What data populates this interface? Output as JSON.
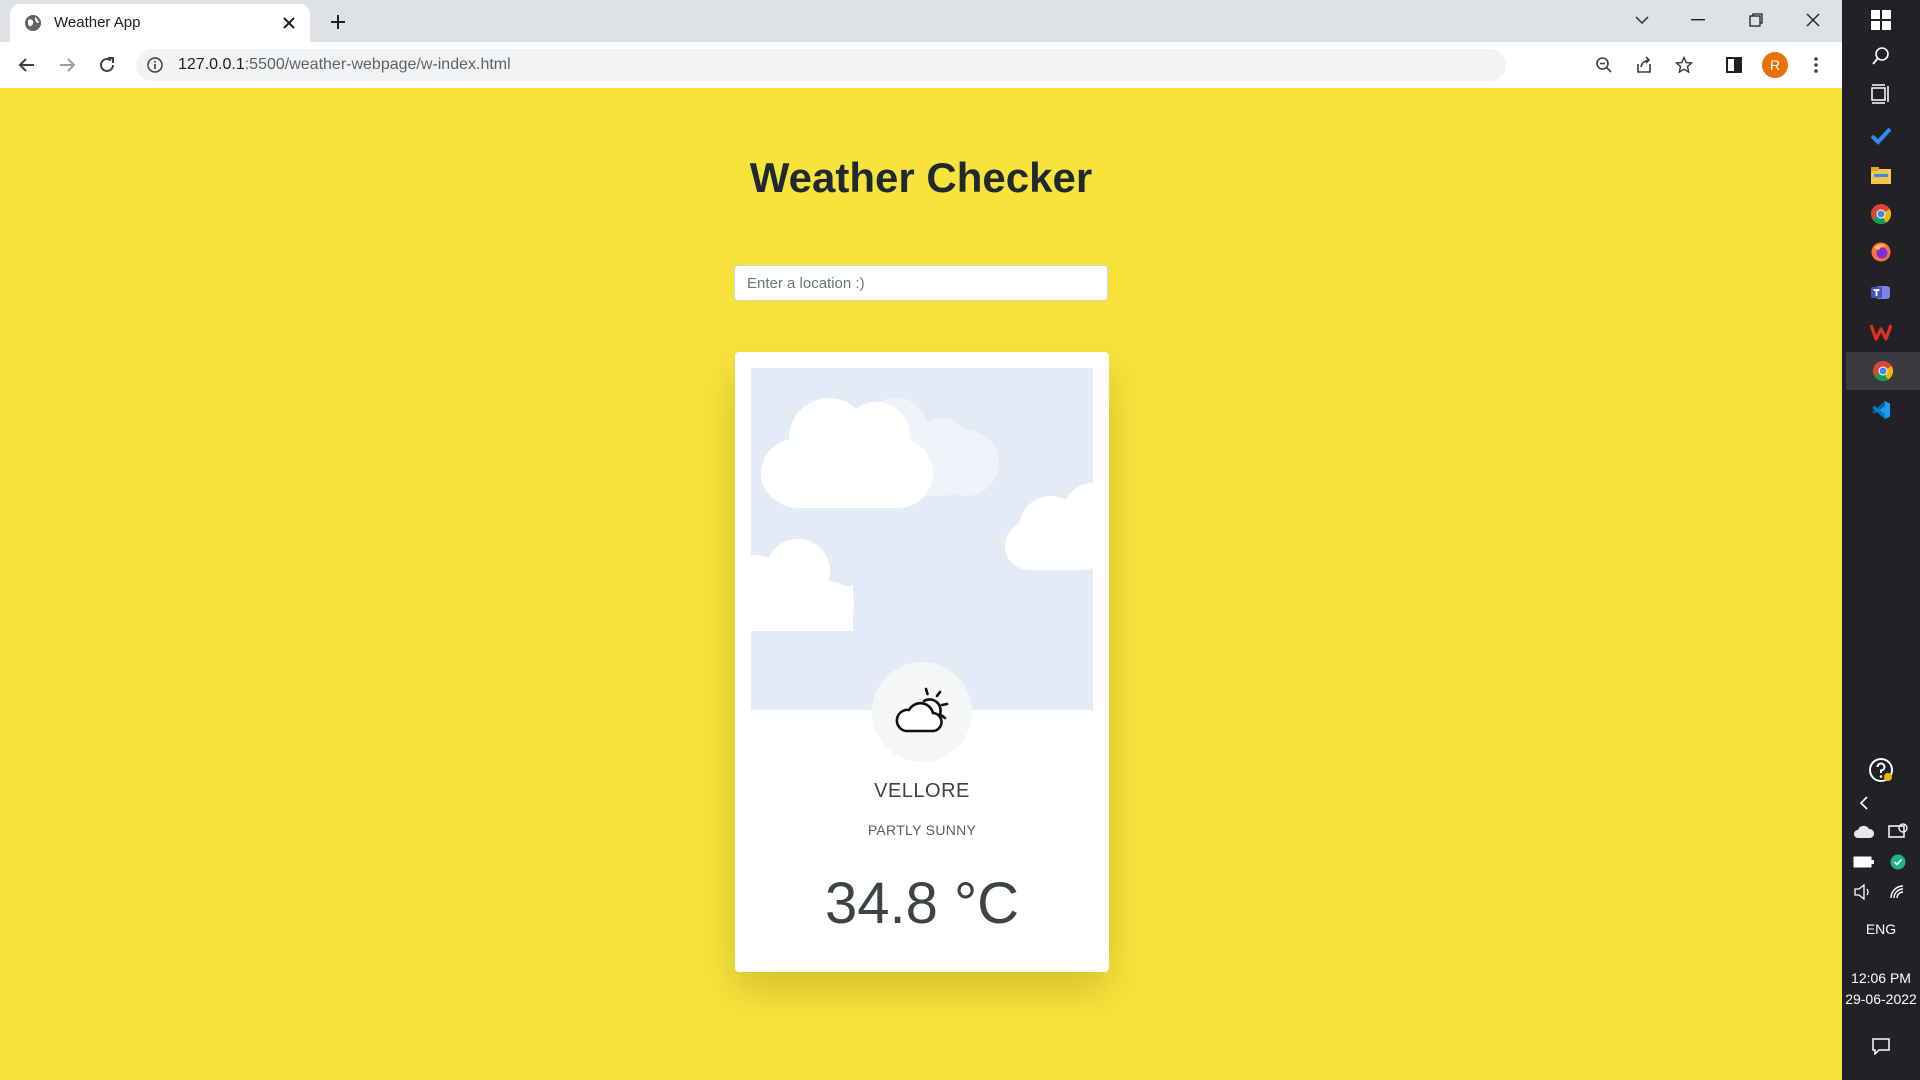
{
  "browser": {
    "tab_title": "Weather App",
    "url_host": "127.0.0.1",
    "url_path": ":5500/weather-webpage/w-index.html",
    "profile_initial": "R"
  },
  "page": {
    "title": "Weather Checker",
    "search_placeholder": "Enter a location :)",
    "search_value": ""
  },
  "weather": {
    "city": "VELLORE",
    "condition": "PARTLY SUNNY",
    "temperature": "34.8 °C",
    "icon": "partly-sunny-icon"
  },
  "taskbar": {
    "language": "ENG",
    "time": "12:06 PM",
    "date": "29-06-2022"
  },
  "colors": {
    "page_background": "#f8e33d",
    "sky_background": "#e5ebf6",
    "profile_avatar": "#e8710a"
  }
}
